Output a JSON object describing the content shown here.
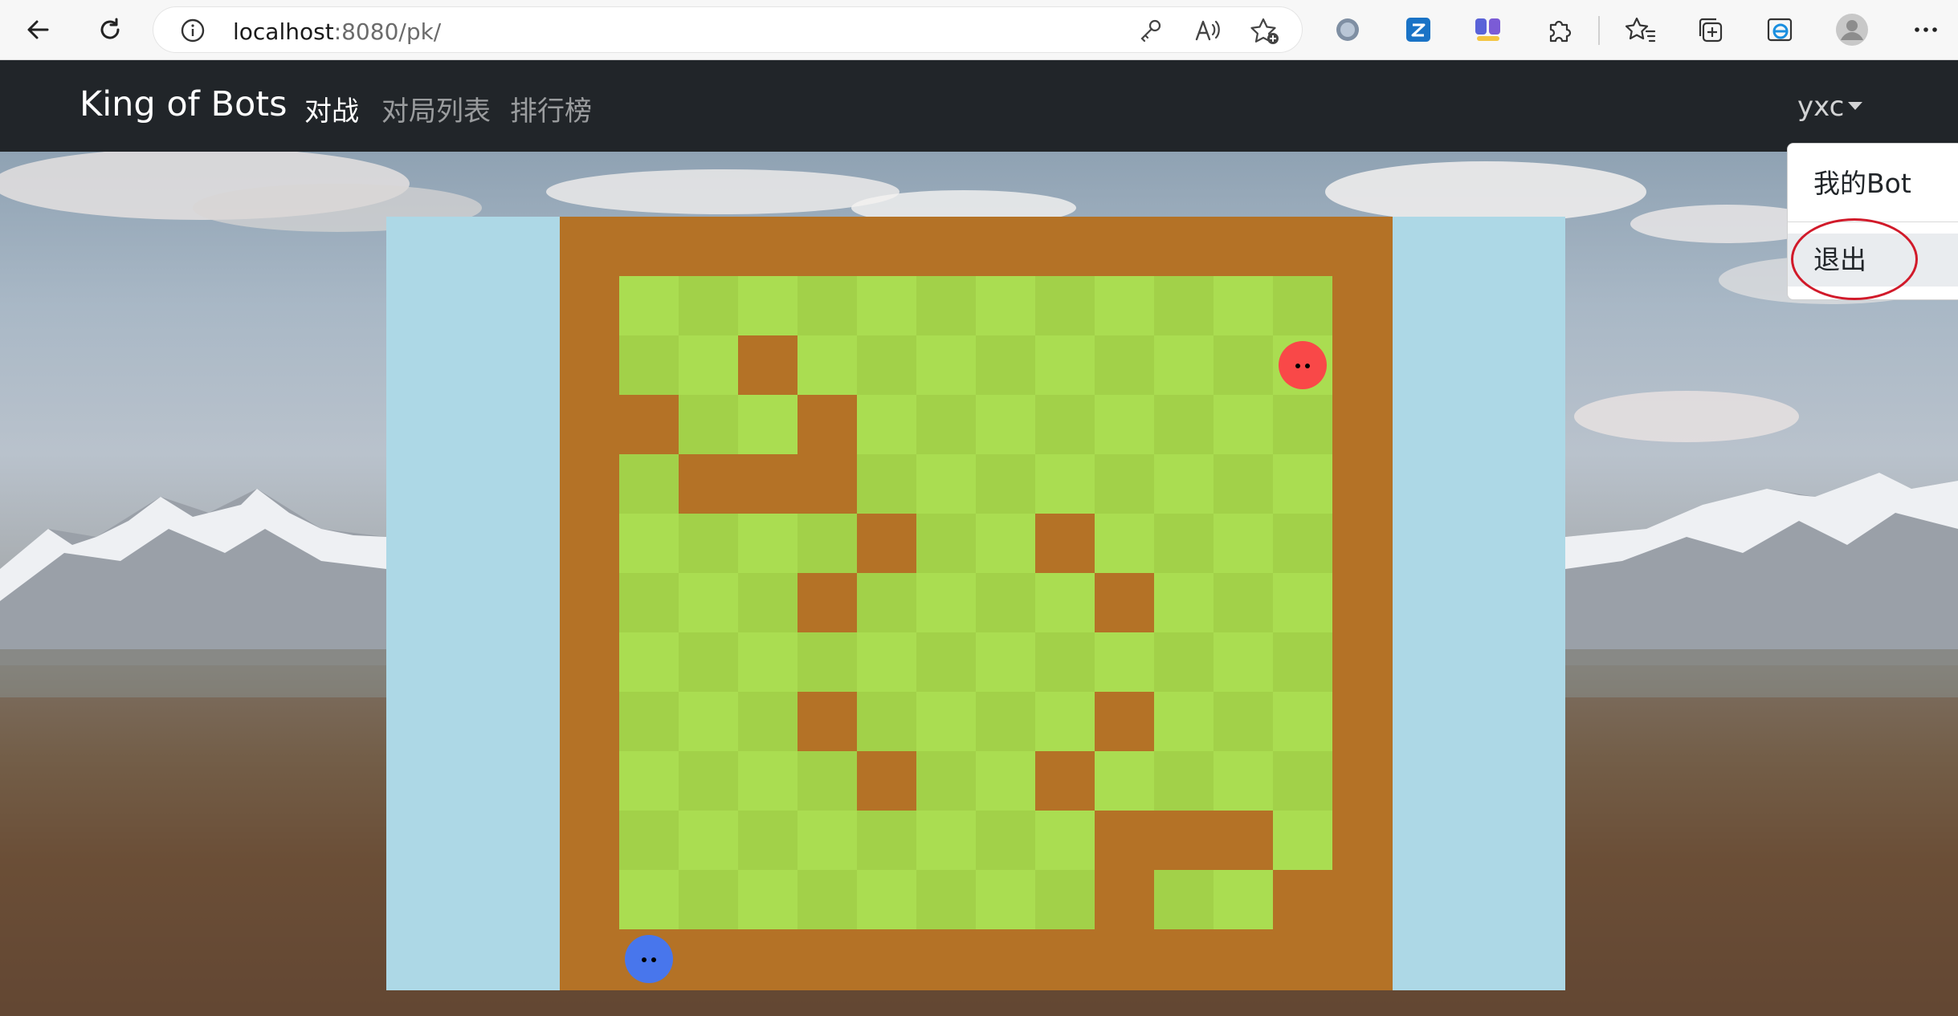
{
  "browser": {
    "url_host": "localhost",
    "url_rest": ":8080/pk/",
    "icons": [
      "back-icon",
      "refresh-icon",
      "info-icon",
      "key-icon",
      "read-aloud-icon",
      "add-favorite-icon",
      "extension-circle-icon",
      "translate-extension-icon",
      "collections-extension-icon",
      "puzzle-icon",
      "favorites-icon",
      "collections-icon",
      "ie-mode-icon",
      "profile-avatar-icon",
      "more-icon"
    ]
  },
  "navbar": {
    "brand": "King of Bots",
    "links": [
      {
        "label": "对战",
        "active": true
      },
      {
        "label": "对局列表",
        "active": false
      },
      {
        "label": "排行榜",
        "active": false
      }
    ],
    "user": "yxc"
  },
  "dropdown": {
    "items": [
      {
        "label": "我的Bot"
      },
      {
        "label": "退出"
      }
    ]
  },
  "game": {
    "rows": 13,
    "cols": 14,
    "colors": {
      "background": "#add8e6",
      "wall": "#b47226",
      "grass_light": "#aadd51",
      "grass_dark": "#a2d149",
      "snake_a": "#4876ec",
      "snake_b": "#f94848"
    },
    "walls": [
      [
        2,
        3
      ],
      [
        3,
        1
      ],
      [
        3,
        4
      ],
      [
        4,
        2
      ],
      [
        4,
        3
      ],
      [
        4,
        4
      ],
      [
        5,
        5
      ],
      [
        5,
        8
      ],
      [
        6,
        4
      ],
      [
        6,
        9
      ],
      [
        8,
        4
      ],
      [
        8,
        9
      ],
      [
        9,
        5
      ],
      [
        9,
        8
      ],
      [
        10,
        9
      ],
      [
        10,
        10
      ],
      [
        10,
        11
      ],
      [
        11,
        9
      ],
      [
        11,
        12
      ],
      [
        12,
        10
      ]
    ],
    "snake_a": {
      "row": 12,
      "col": 1
    },
    "snake_b": {
      "row": 2,
      "col": 12
    }
  }
}
